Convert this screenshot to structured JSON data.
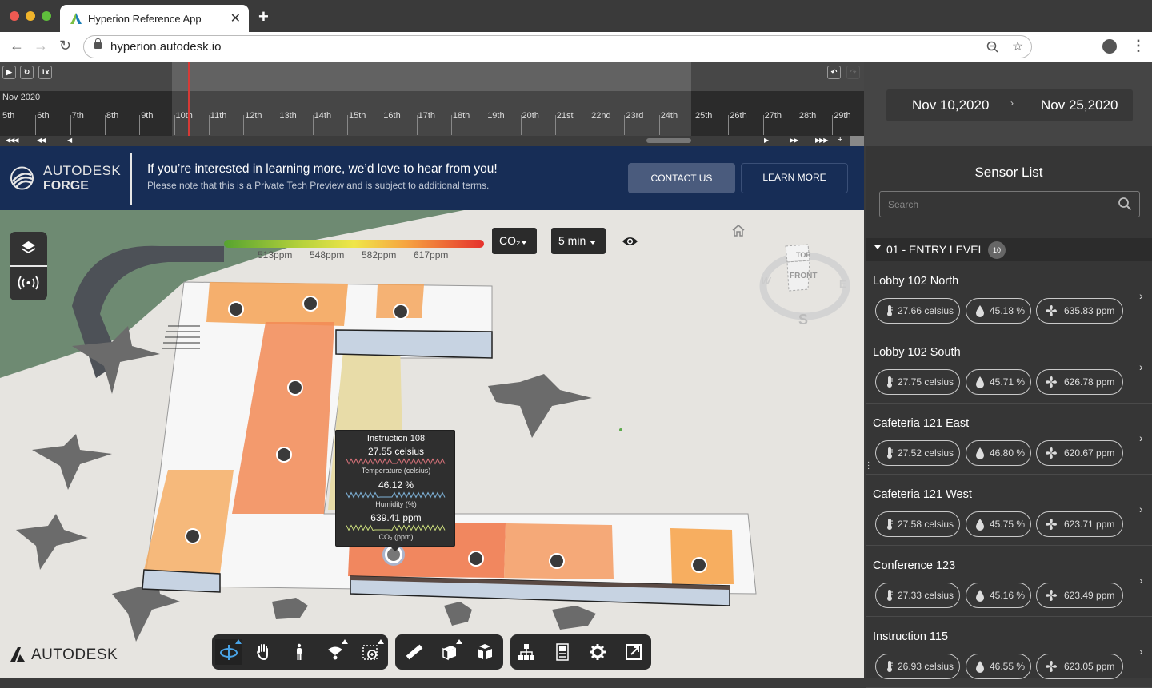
{
  "browser": {
    "tab_title": "Hyperion Reference App",
    "url": "hyperion.autodesk.io"
  },
  "timeline": {
    "speed_label": "1x",
    "month_label": "Nov 2020",
    "days": [
      "5th",
      "6th",
      "7th",
      "8th",
      "9th",
      "10th",
      "11th",
      "12th",
      "13th",
      "14th",
      "15th",
      "16th",
      "17th",
      "18th",
      "19th",
      "20th",
      "21st",
      "22nd",
      "23rd",
      "24th",
      "25th",
      "26th",
      "27th",
      "28th",
      "29th"
    ],
    "selection_start_day": "10th",
    "selection_end_day": "25th",
    "controls": [
      "◀◀◀",
      "◀◀",
      "◀",
      "▶",
      "▶▶",
      "▶▶▶",
      "+"
    ]
  },
  "date_range": {
    "start": "Nov 10,2020",
    "separator": "›",
    "end": "Nov 25,2020"
  },
  "banner": {
    "brand_line1": "AUTODESK",
    "brand_line2": "FORGE",
    "headline": "If you’re interested in learning more, we’d love to hear from you!",
    "subtext": "Please note that this is a Private Tech Preview and is subject to additional terms.",
    "contact_label": "CONTACT US",
    "learn_label": "LEARN MORE"
  },
  "viewer": {
    "legend": {
      "labels": [
        "513ppm",
        "548ppm",
        "582ppm",
        "617ppm"
      ],
      "colors": [
        "#56a32f",
        "#f0e648",
        "#e5312c"
      ]
    },
    "metric_dropdown": "CO₂",
    "interval_dropdown": "5 min",
    "viewcube": {
      "top": "TOP",
      "front": "FRONT",
      "west": "W",
      "east": "E",
      "south": "S"
    },
    "tooltip": {
      "title": "Instruction 108",
      "temperature_value": "27.55 celsius",
      "temperature_label": "Temperature (celsius)",
      "humidity_value": "46.12 %",
      "humidity_label": "Humidity (%)",
      "co2_value": "639.41 ppm",
      "co2_label": "CO₂ (ppm)",
      "spark_colors": {
        "temperature": "#d9737a",
        "humidity": "#7fb3d9",
        "co2": "#c7d97a"
      }
    },
    "toolbar": [
      {
        "name": "orbit",
        "active": true
      },
      {
        "name": "pan"
      },
      {
        "name": "first-person"
      },
      {
        "name": "camera"
      },
      {
        "name": "zoom-window"
      },
      {
        "name": "measure"
      },
      {
        "name": "section"
      },
      {
        "name": "explode"
      },
      {
        "name": "model-browser"
      },
      {
        "name": "properties"
      },
      {
        "name": "settings"
      },
      {
        "name": "fullscreen"
      }
    ],
    "accent_color": "#49a3e6",
    "watermark": "AUTODESK"
  },
  "sensor_panel": {
    "title": "Sensor List",
    "search_placeholder": "Search",
    "group": {
      "label": "01 - ENTRY LEVEL",
      "count": "10"
    },
    "sensors": [
      {
        "name": "Lobby 102 North",
        "temperature": "27.66 celsius",
        "humidity": "45.18 %",
        "co2": "635.83 ppm"
      },
      {
        "name": "Lobby 102 South",
        "temperature": "27.75 celsius",
        "humidity": "45.71 %",
        "co2": "626.78 ppm"
      },
      {
        "name": "Cafeteria 121 East",
        "temperature": "27.52 celsius",
        "humidity": "46.80 %",
        "co2": "620.67 ppm"
      },
      {
        "name": "Cafeteria 121 West",
        "temperature": "27.58 celsius",
        "humidity": "45.75 %",
        "co2": "623.71 ppm"
      },
      {
        "name": "Conference 123",
        "temperature": "27.33 celsius",
        "humidity": "45.16 %",
        "co2": "623.49 ppm"
      },
      {
        "name": "Instruction 115",
        "temperature": "26.93 celsius",
        "humidity": "46.55 %",
        "co2": "623.05 ppm"
      }
    ]
  }
}
